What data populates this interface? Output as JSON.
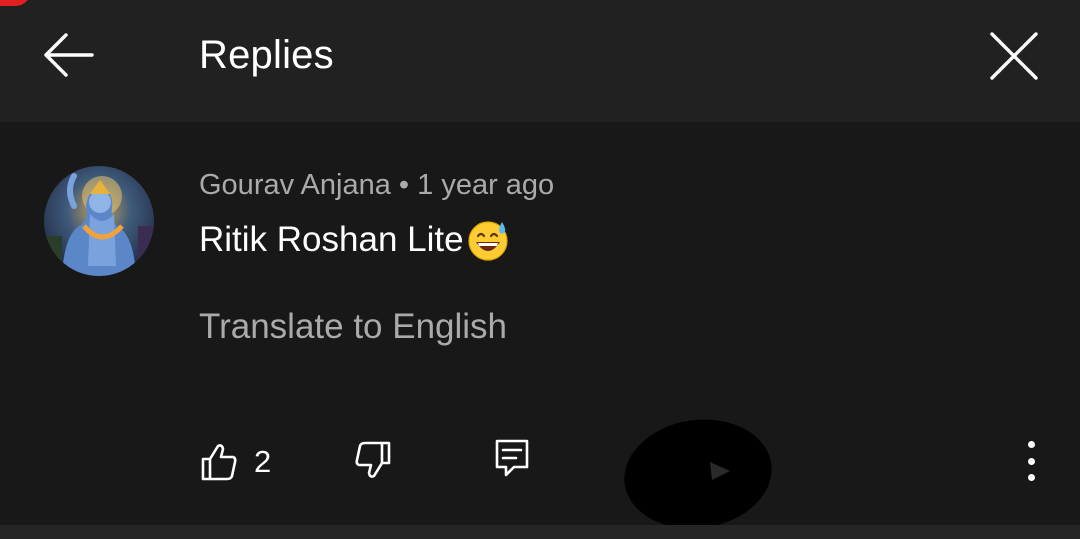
{
  "header": {
    "title": "Replies",
    "back_icon": "arrow-left-icon",
    "close_icon": "close-icon"
  },
  "comment": {
    "author": "Gourav Anjana",
    "separator": "•",
    "age": "1 year ago",
    "text": "Ritik Roshan Lite",
    "emoji": "grinning-face-with-sweat",
    "translate_label": "Translate to English",
    "like_count": "2",
    "icons": {
      "like": "thumbs-up-icon",
      "dislike": "thumbs-down-icon",
      "reply": "reply-icon",
      "more": "more-vertical-icon"
    }
  },
  "colors": {
    "header_bg": "#212121",
    "page_bg": "#181818",
    "primary_text": "#ffffff",
    "secondary_text": "#aaaaaa",
    "notification_badge": "#e02020"
  }
}
